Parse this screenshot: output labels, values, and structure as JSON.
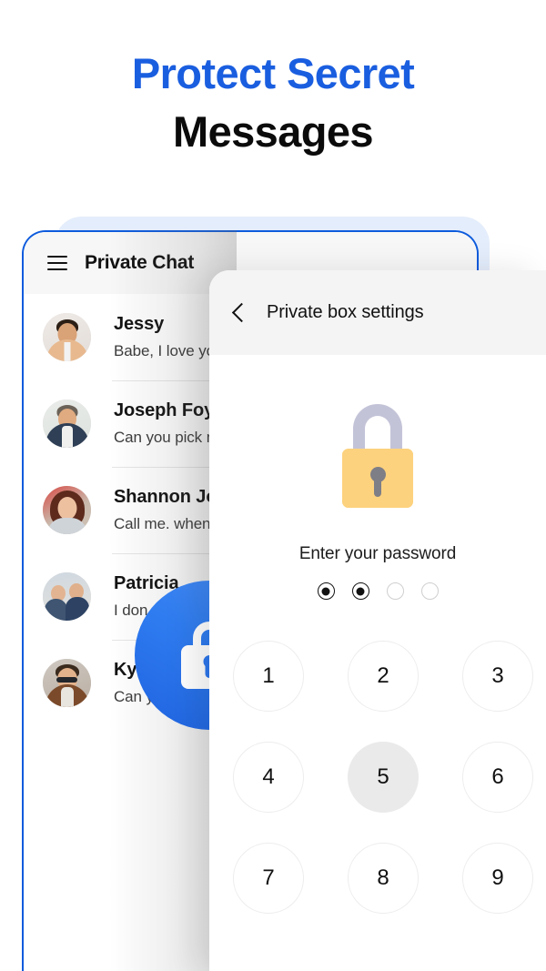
{
  "headline": {
    "line1": "Protect Secret",
    "line2": "Messages",
    "color_line1": "#1a5ee0",
    "color_line2": "#0b0b0b"
  },
  "chat_app": {
    "menu_icon": "hamburger-menu-icon",
    "title": "Private Chat",
    "rows": [
      {
        "avatar": "avatar-jessy",
        "name": "Jessy",
        "message": "Babe, I love you"
      },
      {
        "avatar": "avatar-joseph",
        "name": "Joseph Foy",
        "message": "Can you pick me"
      },
      {
        "avatar": "avatar-shannon",
        "name": "Shannon Jo",
        "message": "Call me. when"
      },
      {
        "avatar": "avatar-patricia",
        "name": "Patricia",
        "message": "I don"
      },
      {
        "avatar": "avatar-kyla",
        "name": "Kyla",
        "message": "Can you"
      }
    ]
  },
  "lock_fab": {
    "icon": "lock-icon",
    "accent": "#2d78ef"
  },
  "settings": {
    "back_icon": "back-chevron-icon",
    "title": "Private box settings",
    "padlock_icon": "padlock-icon",
    "padlock_body_color": "#fcc661",
    "padlock_shackle_color": "#c3c3d8",
    "password_label": "Enter your password",
    "password_dots": [
      {
        "state": "filled"
      },
      {
        "state": "filled"
      },
      {
        "state": "empty"
      },
      {
        "state": "empty"
      }
    ],
    "keypad": [
      {
        "label": "1",
        "active": false
      },
      {
        "label": "2",
        "active": false
      },
      {
        "label": "3",
        "active": false
      },
      {
        "label": "4",
        "active": false
      },
      {
        "label": "5",
        "active": true
      },
      {
        "label": "6",
        "active": false
      },
      {
        "label": "7",
        "active": false
      },
      {
        "label": "8",
        "active": false
      },
      {
        "label": "9",
        "active": false
      }
    ]
  },
  "theme": {
    "brand_blue": "#0d5bdd",
    "backdrop_blue": "#e4edfb",
    "header_gray": "#f7f7f7"
  }
}
